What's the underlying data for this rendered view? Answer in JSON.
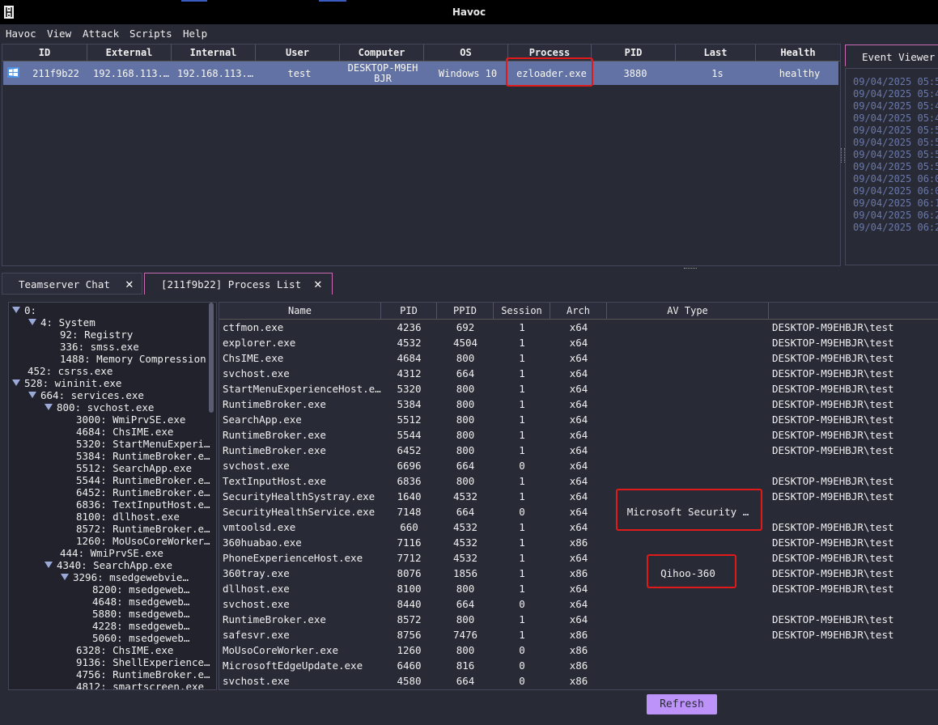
{
  "window": {
    "title": "Havoc"
  },
  "menu": [
    "Havoc",
    "View",
    "Attack",
    "Scripts",
    "Help"
  ],
  "sessions": {
    "columns": [
      "ID",
      "External",
      "Internal",
      "User",
      "Computer",
      "OS",
      "Process",
      "PID",
      "Last",
      "Health"
    ],
    "rows": [
      {
        "id": "211f9b22",
        "external": "192.168.113.…",
        "internal": "192.168.113.…",
        "user": "test",
        "computer": "DESKTOP-M9EHBJR",
        "os": "Windows 10",
        "process": "ezloader.exe",
        "pid": "3880",
        "last": "1s",
        "health": "healthy"
      }
    ]
  },
  "event_viewer": {
    "tab_label": "Event Viewer",
    "lines": [
      "09/04/2025 05:5",
      "09/04/2025 05:4",
      "09/04/2025 05:4",
      "09/04/2025 05:4",
      "09/04/2025 05:5",
      "09/04/2025 05:5",
      "09/04/2025 05:5",
      "09/04/2025 05:5",
      "09/04/2025 06:0",
      "09/04/2025 06:0",
      "09/04/2025 06:1",
      "09/04/2025 06:2",
      "09/04/2025 06:2"
    ]
  },
  "bottom_tabs": [
    {
      "label": "Teamserver Chat"
    },
    {
      "label": "[211f9b22] Process List"
    }
  ],
  "tree": [
    {
      "label": "0:",
      "depth": 0,
      "expanded": true
    },
    {
      "label": "4: System",
      "depth": 1,
      "expanded": true
    },
    {
      "label": "92: Registry",
      "depth": 2
    },
    {
      "label": "336: smss.exe",
      "depth": 2
    },
    {
      "label": "1488: Memory Compression",
      "depth": 2
    },
    {
      "label": "452: csrss.exe",
      "depth": 0
    },
    {
      "label": "528: wininit.exe",
      "depth": 0,
      "expanded": true
    },
    {
      "label": "664: services.exe",
      "depth": 1,
      "expanded": true
    },
    {
      "label": "800: svchost.exe",
      "depth": 2,
      "expanded": true
    },
    {
      "label": "3000: WmiPrvSE.exe",
      "depth": 3
    },
    {
      "label": "4684: ChsIME.exe",
      "depth": 3
    },
    {
      "label": "5320: StartMenuExperi…",
      "depth": 3
    },
    {
      "label": "5384: RuntimeBroker.e…",
      "depth": 3
    },
    {
      "label": "5512: SearchApp.exe",
      "depth": 3
    },
    {
      "label": "5544: RuntimeBroker.e…",
      "depth": 3
    },
    {
      "label": "6452: RuntimeBroker.e…",
      "depth": 3
    },
    {
      "label": "6836: TextInputHost.e…",
      "depth": 3
    },
    {
      "label": "8100: dllhost.exe",
      "depth": 3
    },
    {
      "label": "8572: RuntimeBroker.e…",
      "depth": 3
    },
    {
      "label": "1260: MoUsoCoreWorker…",
      "depth": 3
    },
    {
      "label": "444: WmiPrvSE.exe",
      "depth": 2
    },
    {
      "label": "4340: SearchApp.exe",
      "depth": 2,
      "expanded": true
    },
    {
      "label": "3296: msedgewebvie…",
      "depth": 3,
      "expanded": true
    },
    {
      "label": "8200: msedgeweb…",
      "depth": 4
    },
    {
      "label": "4648: msedgeweb…",
      "depth": 4
    },
    {
      "label": "5880: msedgeweb…",
      "depth": 4
    },
    {
      "label": "4228: msedgeweb…",
      "depth": 4
    },
    {
      "label": "5060: msedgeweb…",
      "depth": 4
    },
    {
      "label": "6328: ChsIME.exe",
      "depth": 3
    },
    {
      "label": "9136: ShellExperience…",
      "depth": 3
    },
    {
      "label": "4756: RuntimeBroker.e…",
      "depth": 3
    },
    {
      "label": "4812: smartscreen.exe",
      "depth": 3
    }
  ],
  "process_list": {
    "columns": [
      "Name",
      "PID",
      "PPID",
      "Session",
      "Arch",
      "AV Type",
      ""
    ],
    "rows": [
      [
        "ctfmon.exe",
        "4236",
        "692",
        "1",
        "x64",
        "",
        "DESKTOP-M9EHBJR\\test"
      ],
      [
        "explorer.exe",
        "4532",
        "4504",
        "1",
        "x64",
        "",
        "DESKTOP-M9EHBJR\\test"
      ],
      [
        "ChsIME.exe",
        "4684",
        "800",
        "1",
        "x64",
        "",
        "DESKTOP-M9EHBJR\\test"
      ],
      [
        "svchost.exe",
        "4312",
        "664",
        "1",
        "x64",
        "",
        "DESKTOP-M9EHBJR\\test"
      ],
      [
        "StartMenuExperienceHost.e…",
        "5320",
        "800",
        "1",
        "x64",
        "",
        "DESKTOP-M9EHBJR\\test"
      ],
      [
        "RuntimeBroker.exe",
        "5384",
        "800",
        "1",
        "x64",
        "",
        "DESKTOP-M9EHBJR\\test"
      ],
      [
        "SearchApp.exe",
        "5512",
        "800",
        "1",
        "x64",
        "",
        "DESKTOP-M9EHBJR\\test"
      ],
      [
        "RuntimeBroker.exe",
        "5544",
        "800",
        "1",
        "x64",
        "",
        "DESKTOP-M9EHBJR\\test"
      ],
      [
        "RuntimeBroker.exe",
        "6452",
        "800",
        "1",
        "x64",
        "",
        "DESKTOP-M9EHBJR\\test"
      ],
      [
        "svchost.exe",
        "6696",
        "664",
        "0",
        "x64",
        "",
        ""
      ],
      [
        "TextInputHost.exe",
        "6836",
        "800",
        "1",
        "x64",
        "",
        "DESKTOP-M9EHBJR\\test"
      ],
      [
        "SecurityHealthSystray.exe",
        "1640",
        "4532",
        "1",
        "x64",
        "",
        "DESKTOP-M9EHBJR\\test"
      ],
      [
        "SecurityHealthService.exe",
        "7148",
        "664",
        "0",
        "x64",
        "Microsoft Security …",
        ""
      ],
      [
        "vmtoolsd.exe",
        "660",
        "4532",
        "1",
        "x64",
        "",
        "DESKTOP-M9EHBJR\\test"
      ],
      [
        "360huabao.exe",
        "7116",
        "4532",
        "1",
        "x86",
        "",
        "DESKTOP-M9EHBJR\\test"
      ],
      [
        "PhoneExperienceHost.exe",
        "7712",
        "4532",
        "1",
        "x64",
        "",
        "DESKTOP-M9EHBJR\\test"
      ],
      [
        "360tray.exe",
        "8076",
        "1856",
        "1",
        "x86",
        "Qihoo-360",
        "DESKTOP-M9EHBJR\\test"
      ],
      [
        "dllhost.exe",
        "8100",
        "800",
        "1",
        "x64",
        "",
        "DESKTOP-M9EHBJR\\test"
      ],
      [
        "svchost.exe",
        "8440",
        "664",
        "0",
        "x64",
        "",
        ""
      ],
      [
        "RuntimeBroker.exe",
        "8572",
        "800",
        "1",
        "x64",
        "",
        "DESKTOP-M9EHBJR\\test"
      ],
      [
        "safesvr.exe",
        "8756",
        "7476",
        "1",
        "x86",
        "",
        "DESKTOP-M9EHBJR\\test"
      ],
      [
        "MoUsoCoreWorker.exe",
        "1260",
        "800",
        "0",
        "x86",
        "",
        ""
      ],
      [
        "MicrosoftEdgeUpdate.exe",
        "6460",
        "816",
        "0",
        "x86",
        "",
        ""
      ],
      [
        "svchost.exe",
        "4580",
        "664",
        "0",
        "x86",
        "",
        ""
      ]
    ]
  },
  "refresh_label": "Refresh",
  "colors": {
    "background": "#282a36",
    "selection": "#6272a4",
    "accent": "#bd93f9",
    "highlight_box": "#e01919"
  }
}
